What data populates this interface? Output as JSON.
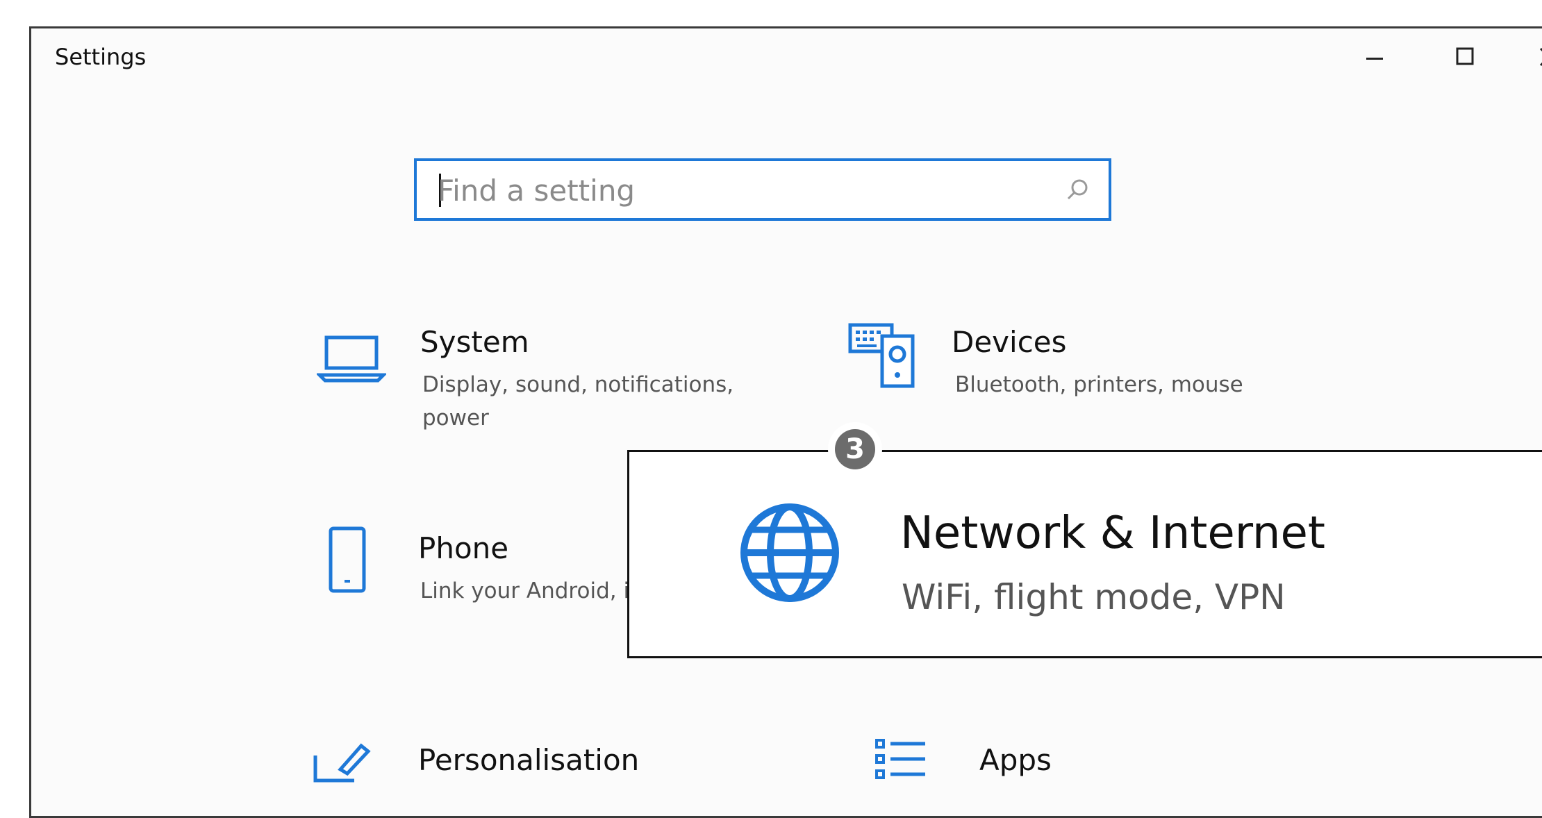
{
  "window": {
    "title": "Settings"
  },
  "search": {
    "placeholder": "Find a setting"
  },
  "tiles": [
    {
      "label": "System",
      "desc": "Display, sound, notifications, power",
      "icon": "laptop-icon"
    },
    {
      "label": "Devices",
      "desc": "Bluetooth, printers, mouse",
      "icon": "devices-icon"
    },
    {
      "label": "Phone",
      "desc": "Link your Android, iP",
      "icon": "phone-icon"
    },
    {
      "label": "Personalisation",
      "icon": "personalisation-icon"
    },
    {
      "label": "Apps",
      "icon": "apps-icon"
    }
  ],
  "callout": {
    "number": "3",
    "title": "Network & Internet",
    "desc": "WiFi, flight mode, VPN",
    "icon": "globe-icon"
  },
  "colors": {
    "accent": "#1e78d7",
    "text": "#111111",
    "subtext": "#555555"
  }
}
